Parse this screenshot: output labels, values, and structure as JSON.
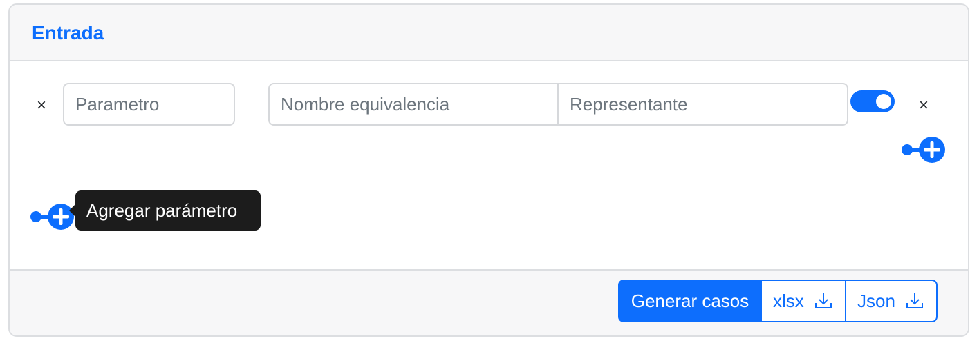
{
  "header": {
    "title": "Entrada"
  },
  "parameter_row": {
    "remove_label": "×",
    "parameter_placeholder": "Parametro",
    "equivalence_name_placeholder": "Nombre equivalencia",
    "representative_placeholder": "Representante",
    "toggle_on": true,
    "remove_equivalence_label": "×"
  },
  "add_parameter": {
    "tooltip": "Agregar parámetro"
  },
  "footer": {
    "generate_label": "Generar casos",
    "xlsx_label": "xlsx",
    "json_label": "Json"
  },
  "colors": {
    "accent": "#0d6efd",
    "tooltip_bg": "#1c1c1c",
    "header_bg": "#f7f7f8"
  },
  "icons": [
    "close-icon",
    "toggle-switch",
    "add-circle-icon",
    "download-icon"
  ]
}
